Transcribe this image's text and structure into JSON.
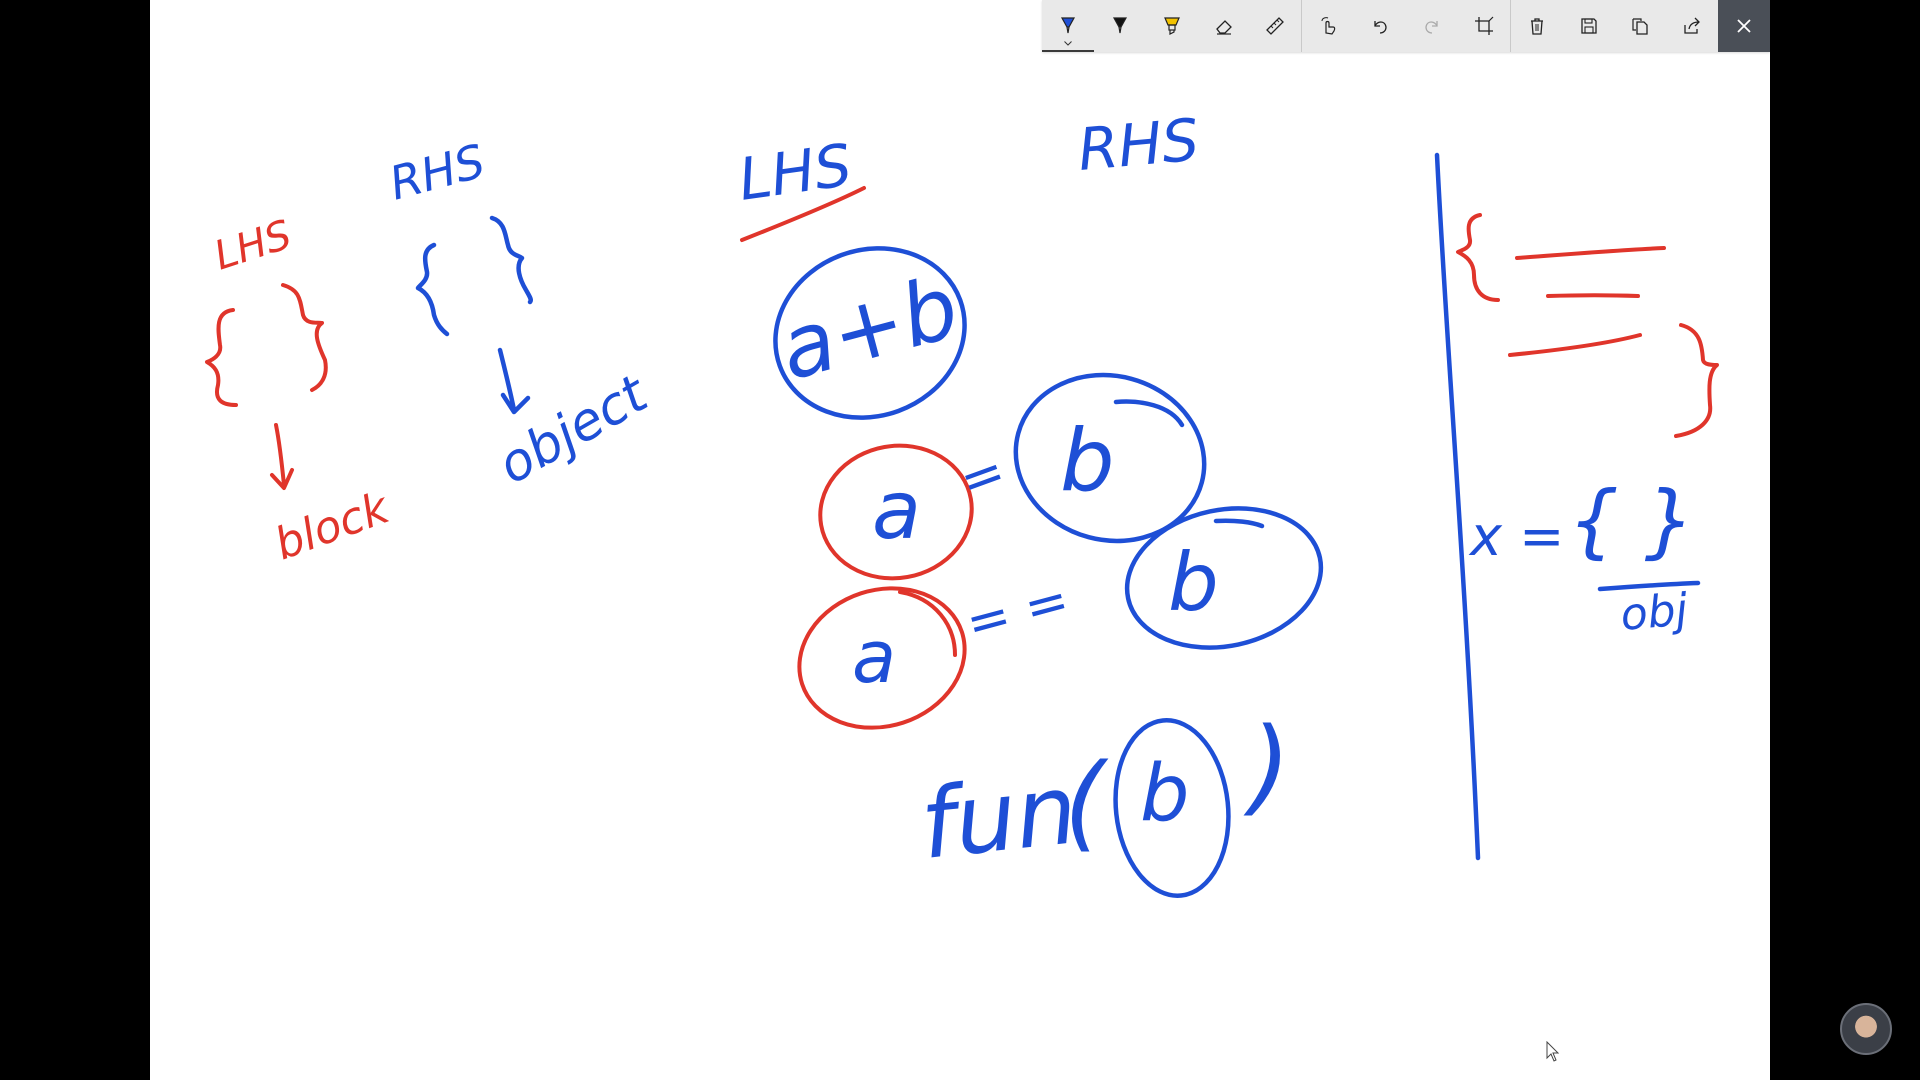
{
  "toolbar": {
    "tools": [
      {
        "name": "ballpoint-pen",
        "label": ""
      },
      {
        "name": "pencil",
        "label": ""
      },
      {
        "name": "highlighter",
        "label": ""
      },
      {
        "name": "eraser",
        "label": ""
      },
      {
        "name": "ruler",
        "label": ""
      },
      {
        "name": "touch-writing",
        "label": ""
      },
      {
        "name": "undo",
        "label": ""
      },
      {
        "name": "redo",
        "label": ""
      },
      {
        "name": "crop",
        "label": ""
      },
      {
        "name": "delete",
        "label": ""
      },
      {
        "name": "save",
        "label": ""
      },
      {
        "name": "copy",
        "label": ""
      },
      {
        "name": "share",
        "label": ""
      },
      {
        "name": "close",
        "label": ""
      }
    ],
    "colors": {
      "pen_blue": "#1e4fd6",
      "pen_black": "#111111",
      "highlighter_yellow": "#f2c200",
      "close_bg": "#4a4f57"
    }
  },
  "ink": {
    "left_red_lhs": "LHS",
    "left_blue_rhs": "RHS",
    "red_block": "block",
    "blue_object": "object",
    "center_lhs": "LHS",
    "center_rhs": "RHS",
    "expr_a_plus_b": "a+b",
    "a1": "a",
    "eq1": "=",
    "b1": "b",
    "a2": "a",
    "eq2": "= =",
    "b2": "b",
    "fun": "fun",
    "paren_open": "(",
    "b3": "b",
    "paren_close": ")",
    "x_eq": "x =",
    "brace_pair": "{ }",
    "obj": "obj",
    "colors": {
      "blue": "#1e4fd6",
      "red": "#e0352b"
    }
  }
}
